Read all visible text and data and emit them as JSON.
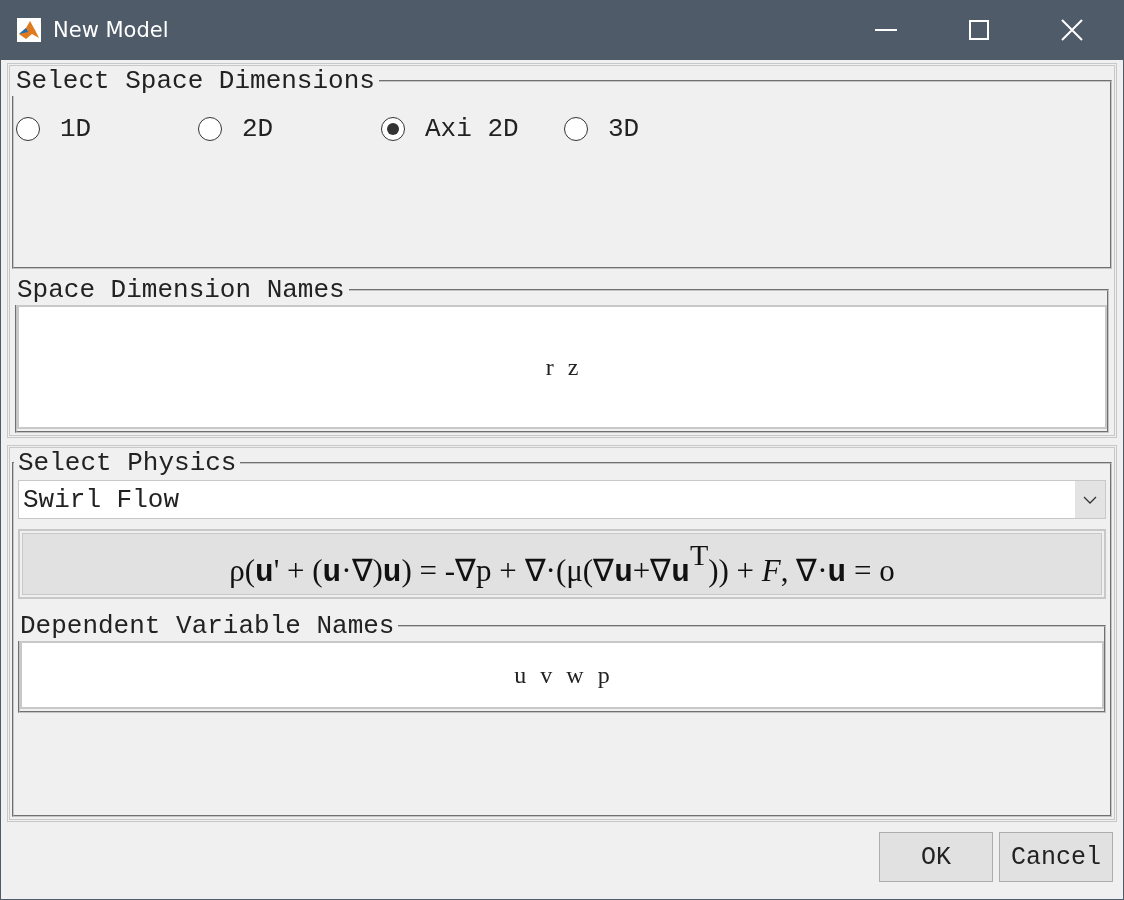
{
  "window": {
    "title": "New Model"
  },
  "space_dimensions": {
    "legend": "Select Space Dimensions",
    "options": [
      {
        "label": "1D",
        "selected": false
      },
      {
        "label": "2D",
        "selected": false
      },
      {
        "label": "Axi 2D",
        "selected": true
      },
      {
        "label": "3D",
        "selected": false
      }
    ]
  },
  "space_dimension_names": {
    "legend": "Space Dimension Names",
    "value": "r z"
  },
  "physics": {
    "legend": "Select Physics",
    "value": "Swirl Flow",
    "equation": "ρ(**u**' + (**u**·∇)**u**) = -∇p + ∇·(μ(∇**u**+∇**u**$^{T}$)) + *F*, ∇·**u** = o"
  },
  "dependent_variable_names": {
    "legend": "Dependent Variable Names",
    "value": "u v w p"
  },
  "buttons": [
    "OK",
    "Cancel"
  ]
}
